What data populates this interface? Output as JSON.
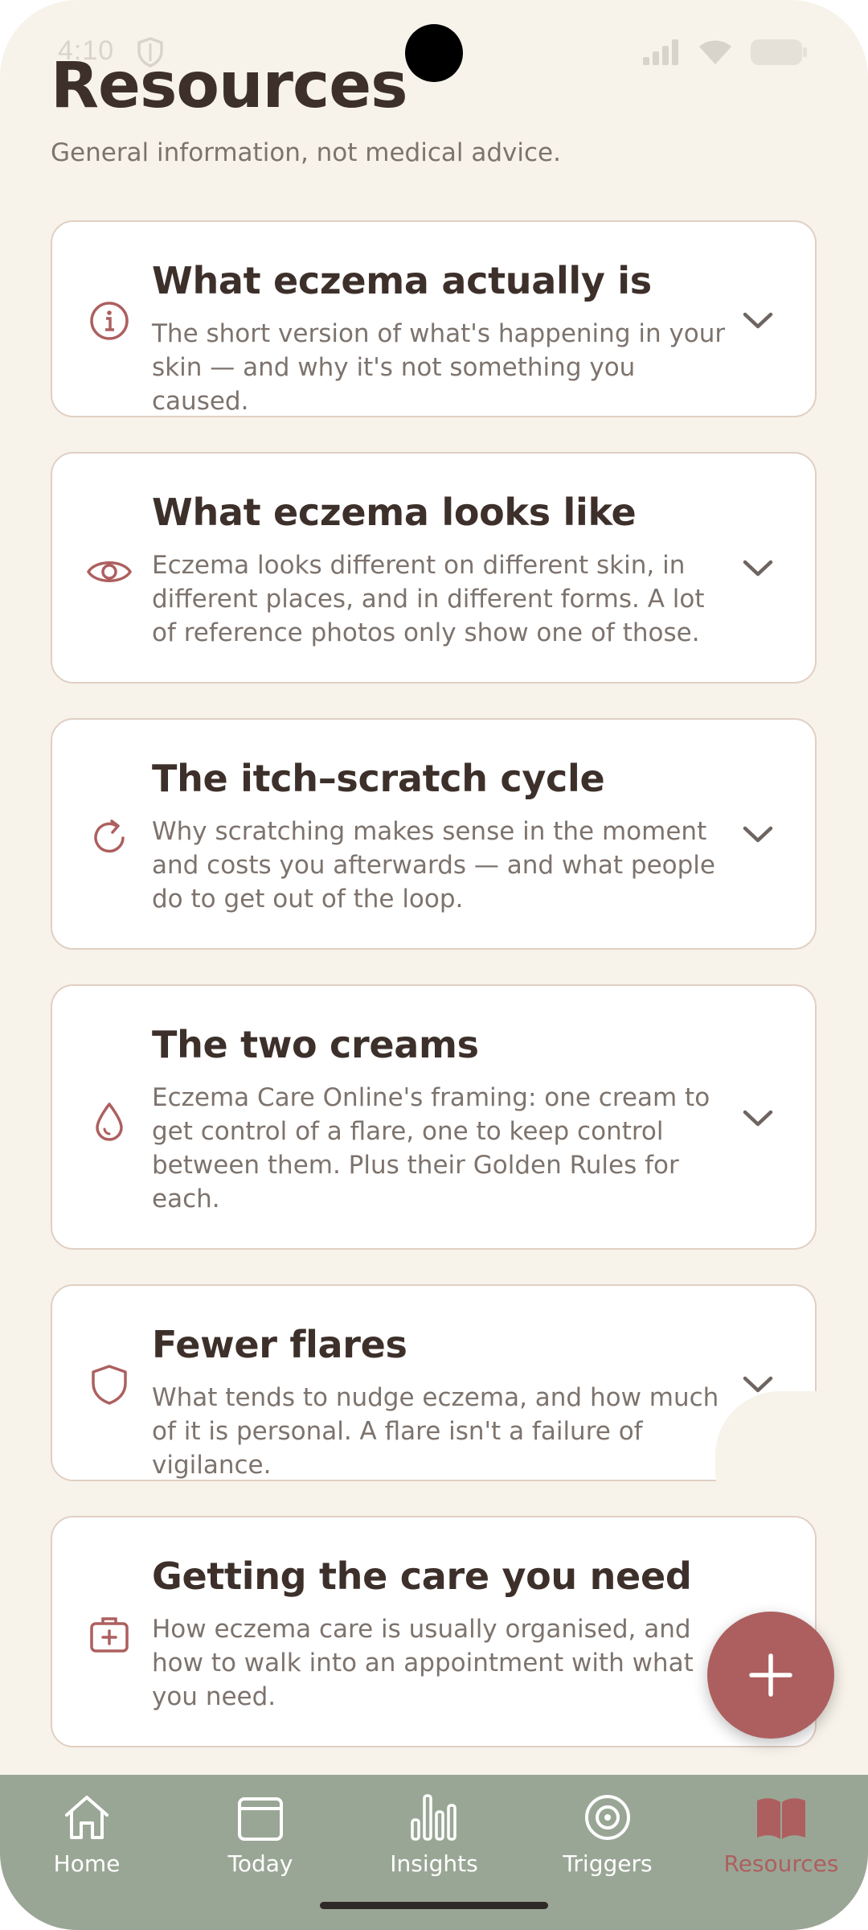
{
  "status": {
    "time": "4:10"
  },
  "header": {
    "title": "Resources",
    "subtitle": "General information, not medical advice."
  },
  "cards": [
    {
      "title": "What eczema actually is",
      "description": "The short version of what's happening in your skin — and why it's not something you caused.",
      "icon": "info-icon"
    },
    {
      "title": "What eczema looks like",
      "description": "Eczema looks different on different skin, in different places, and in different forms. A lot of reference photos only show one of those.",
      "icon": "eye-icon"
    },
    {
      "title": "The itch–scratch cycle",
      "description": "Why scratching makes sense in the moment and costs you afterwards — and what people do to get out of the loop.",
      "icon": "refresh-icon"
    },
    {
      "title": "The two creams",
      "description": "Eczema Care Online's framing: one cream to get control of a flare, one to keep control between them. Plus their Golden Rules for each.",
      "icon": "droplet-icon"
    },
    {
      "title": "Fewer flares",
      "description": "What tends to nudge eczema, and how much of it is personal. A flare isn't a failure of vigilance.",
      "icon": "shield-icon"
    },
    {
      "title": "Getting the care you need",
      "description": "How eczema care is usually organised, and how to walk into an appointment with what you need.",
      "icon": "medical-kit-icon"
    }
  ],
  "tabs": [
    {
      "label": "Home",
      "icon": "home-icon"
    },
    {
      "label": "Today",
      "icon": "calendar-icon"
    },
    {
      "label": "Insights",
      "icon": "bar-chart-icon"
    },
    {
      "label": "Triggers",
      "icon": "target-icon"
    },
    {
      "label": "Resources",
      "icon": "book-icon",
      "active": true
    }
  ],
  "colors": {
    "background": "#f7f3ea",
    "accent": "#ad5f5f",
    "tabbar": "#9aa695",
    "text": "#3d302b",
    "muted": "#7d736d"
  }
}
